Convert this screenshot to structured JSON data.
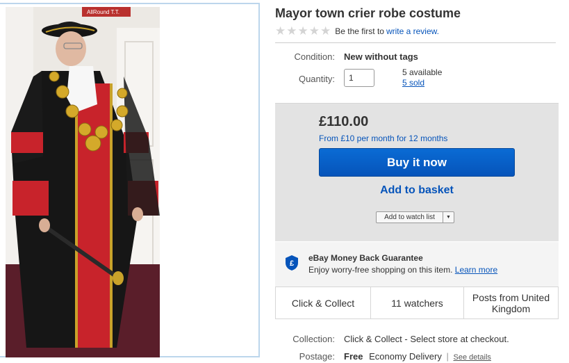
{
  "listing": {
    "title": "Mayor town crier robe costume",
    "rating": {
      "stars": 0,
      "max_stars": 5,
      "prompt_text": "Be the first to",
      "review_link": "write a review."
    },
    "condition_label": "Condition:",
    "condition_value": "New without tags",
    "quantity_label": "Quantity:",
    "quantity_value": "1",
    "available_text": "5 available",
    "sold_text": "5 sold"
  },
  "image": {
    "sign_text": "AllRound T.T."
  },
  "buy_box": {
    "price": "£110.00",
    "finance_text": "From £10 per month for 12 months",
    "buy_now_label": "Buy it now",
    "add_basket_label": "Add to basket",
    "watch_label": "Add to watch list"
  },
  "guarantee": {
    "icon_letter": "£",
    "title": "eBay Money Back Guarantee",
    "text": "Enjoy worry-free shopping on this item.",
    "link": "Learn more"
  },
  "info_cells": {
    "collect": "Click & Collect",
    "watchers": "11 watchers",
    "posts_from": "Posts from United Kingdom"
  },
  "collection": {
    "label": "Collection:",
    "value": "Click & Collect - Select store at checkout."
  },
  "postage": {
    "label": "Postage:",
    "free": "Free",
    "method": "Economy Delivery",
    "separator": "|",
    "details_link": "See details"
  },
  "colors": {
    "link_blue": "#0654ba",
    "buy_button": "#0654ba",
    "buy_box_bg": "#e3e3e3",
    "robe_red": "#c8232b"
  }
}
